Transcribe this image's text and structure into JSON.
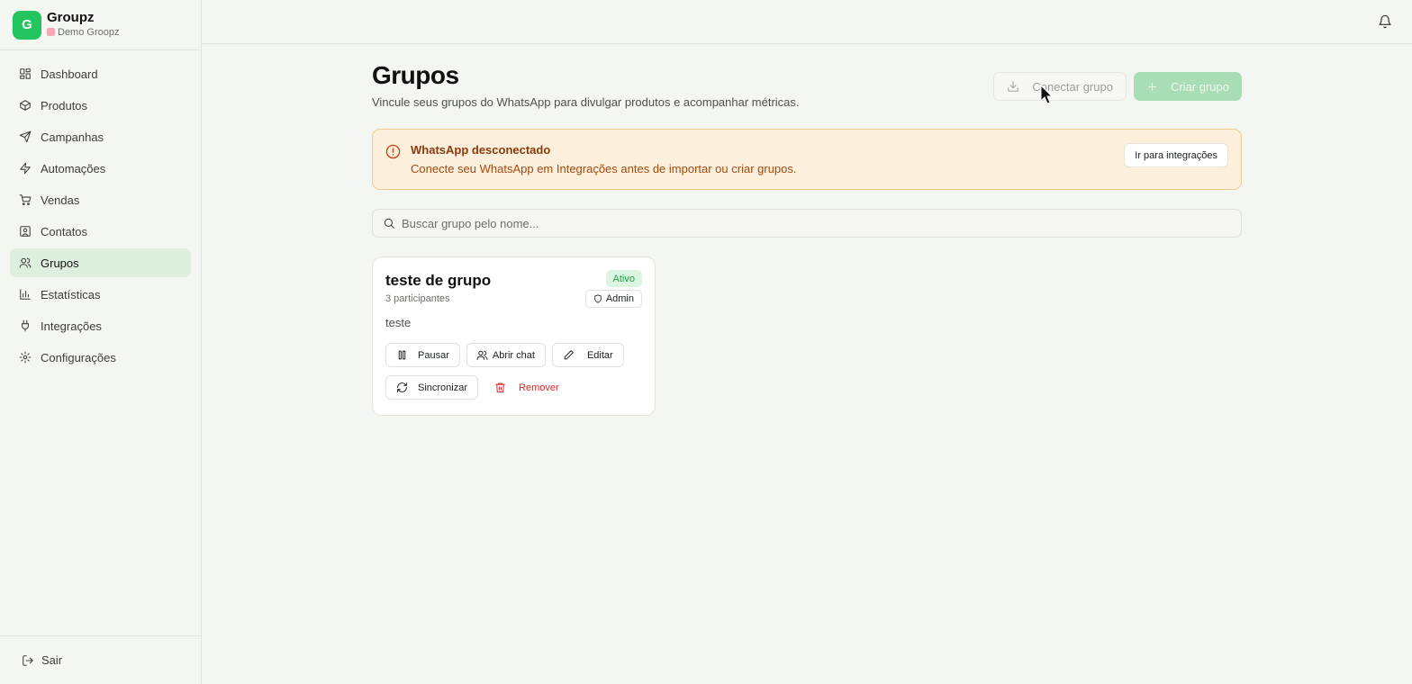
{
  "brand": {
    "initial": "G",
    "name": "Groupz",
    "workspace": "Demo Groopz"
  },
  "sidebar": {
    "items": [
      {
        "label": "Dashboard",
        "icon": "dashboard-icon"
      },
      {
        "label": "Produtos",
        "icon": "box-icon"
      },
      {
        "label": "Campanhas",
        "icon": "send-icon"
      },
      {
        "label": "Automações",
        "icon": "zap-icon"
      },
      {
        "label": "Vendas",
        "icon": "cart-icon"
      },
      {
        "label": "Contatos",
        "icon": "contact-icon"
      },
      {
        "label": "Grupos",
        "icon": "users-icon",
        "active": true
      },
      {
        "label": "Estatísticas",
        "icon": "bar-chart-icon"
      },
      {
        "label": "Integrações",
        "icon": "plug-icon"
      },
      {
        "label": "Configurações",
        "icon": "gear-icon"
      }
    ],
    "logout_label": "Sair"
  },
  "header": {
    "title": "Grupos",
    "subtitle": "Vincule seus grupos do WhatsApp para divulgar produtos e acompanhar métricas.",
    "connect_label": "Conectar grupo",
    "create_label": "Criar grupo"
  },
  "alert": {
    "title": "WhatsApp desconectado",
    "body": "Conecte seu WhatsApp em Integrações antes de importar ou criar grupos.",
    "button_label": "Ir para integrações"
  },
  "search": {
    "placeholder": "Buscar grupo pelo nome..."
  },
  "groups": [
    {
      "name": "teste de grupo",
      "participants": "3 participantes",
      "status": "Ativo",
      "role": "Admin",
      "description": "teste",
      "actions": {
        "pause": "Pausar",
        "open_chat": "Abrir chat",
        "edit": "Editar",
        "sync": "Sincronizar",
        "remove": "Remover"
      }
    }
  ],
  "colors": {
    "brand": "#22c55e",
    "active_nav_bg": "#ddefdf",
    "warning_bg": "#fcefdc",
    "danger": "#dc2626"
  }
}
